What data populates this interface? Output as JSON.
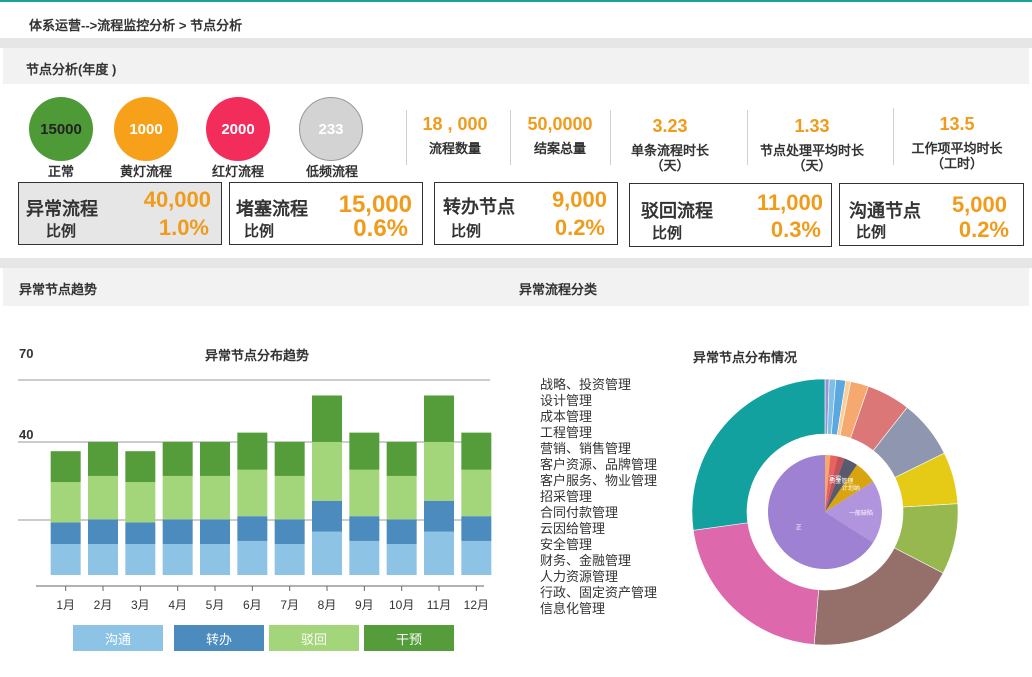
{
  "breadcrumb": "体系运营-->流程监控分析 >  节点分析",
  "section1": {
    "title": "节点分析(年度 )"
  },
  "circles": [
    {
      "value": "15000",
      "label": "正常",
      "color": "#4e9a37",
      "text_color": "#222222"
    },
    {
      "value": "1000",
      "label": "黄灯流程",
      "color": "#f7a11a",
      "text_color": "#ffffff"
    },
    {
      "value": "2000",
      "label": "红灯流程",
      "color": "#f22d5c",
      "text_color": "#ffffff"
    },
    {
      "value": "233",
      "label": "低频流程",
      "color": "#d3d3d3",
      "text_color": "#ffffff"
    }
  ],
  "stats": [
    {
      "value": "18 , 000",
      "label": "流程数量"
    },
    {
      "value": "50,0000",
      "label": "结案总量"
    },
    {
      "value": "3.23",
      "label": "单条流程时长",
      "label2": "（天）"
    },
    {
      "value": "1.33",
      "label": "节点处理平均时长",
      "label2": "（天）"
    },
    {
      "value": "13.5",
      "label": "工作项平均时长",
      "label2": "（工时）"
    }
  ],
  "cards": [
    {
      "title": "异常流程",
      "value": "40,000",
      "ratio_label": "比例",
      "ratio": "1.0%",
      "active": true
    },
    {
      "title": "堵塞流程",
      "value": "15,000",
      "ratio_label": "比例",
      "ratio": "0.6%",
      "active": false
    },
    {
      "title": "转办节点",
      "value": "9,000",
      "ratio_label": "比例",
      "ratio": "0.2%",
      "active": false
    },
    {
      "title": "驳回流程",
      "value": "11,000",
      "ratio_label": "比例",
      "ratio": "0.3%",
      "active": false
    },
    {
      "title": "沟通节点",
      "value": "5,000",
      "ratio_label": "比例",
      "ratio": "0.2%",
      "active": false
    }
  ],
  "section2": {
    "left_title": "异常节点趋势",
    "right_title": "异常流程分类"
  },
  "colors": {
    "accent": "#f09b1b",
    "teal": "#1aa394"
  },
  "chart_data": [
    {
      "type": "bar",
      "stacked": true,
      "title": "异常节点分布趋势",
      "categories": [
        "1月",
        "2月",
        "3月",
        "4月",
        "5月",
        "6月",
        "7月",
        "8月",
        "9月",
        "10月",
        "11月",
        "12月"
      ],
      "series": [
        {
          "name": "沟通",
          "color": "#8dc4e6",
          "values": [
            10,
            10,
            10,
            10,
            10,
            11,
            10,
            14,
            11,
            10,
            14,
            11
          ]
        },
        {
          "name": "转办",
          "color": "#4b8bbe",
          "values": [
            7,
            8,
            7,
            8,
            8,
            8,
            8,
            10,
            8,
            8,
            10,
            8
          ]
        },
        {
          "name": "驳回",
          "color": "#a3d67a",
          "values": [
            13,
            14,
            13,
            14,
            14,
            15,
            14,
            19,
            15,
            14,
            19,
            15
          ]
        },
        {
          "name": "干预",
          "color": "#559d3a",
          "values": [
            10,
            11,
            10,
            11,
            11,
            12,
            11,
            15,
            12,
            11,
            15,
            12
          ]
        }
      ],
      "y_ticks": [
        "70",
        "40"
      ],
      "ylim": [
        0,
        63
      ],
      "grid": true,
      "legend": "bottom"
    },
    {
      "type": "pie",
      "title": "异常节点分布情况",
      "categories": [
        "战略、投资管理",
        "设计管理",
        "成本管理",
        "工程管理",
        "营销、销售管理",
        "客户资源、品牌管理",
        "客户服务、物业管理",
        "招采管理",
        "合同付款管理",
        "云因给管理",
        "安全管理",
        "财务、金融管理",
        "人力资源管理",
        "行政、固定资产管理",
        "信息化管理"
      ],
      "outer_ring": {
        "values": [
          0.5,
          0.8,
          1.2,
          0.6,
          2.2,
          5.3,
          7.1,
          6.3,
          8.6,
          18.7,
          21.5,
          27.2
        ],
        "colors": [
          "#9c8fd6",
          "#7ec0e3",
          "#5aa8e0",
          "#f9cf9a",
          "#f5a96e",
          "#dc7778",
          "#8f97b0",
          "#e6cb16",
          "#96b84f",
          "#95706a",
          "#dd68ac",
          "#12a19f"
        ]
      },
      "inner_ring": {
        "values": [
          1.5,
          2,
          2,
          4,
          6.5,
          18,
          66
        ],
        "colors": [
          "#f5a96e",
          "#e8625f",
          "#c3515a",
          "#5a5a6e",
          "#d8a510",
          "#b094dd",
          "#9f81d3"
        ],
        "labels": [
          "",
          "",
          "定理",
          "资金管理",
          "计划纳",
          "一般缺陷",
          "正"
        ]
      }
    }
  ]
}
